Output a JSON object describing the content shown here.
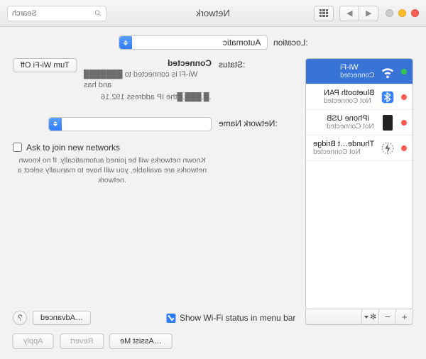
{
  "window": {
    "title": "Network",
    "search_placeholder": "Search"
  },
  "location": {
    "label": "Location:",
    "value": "Automatic"
  },
  "services": [
    {
      "id": "wifi",
      "name": "Wi-Fi",
      "status": "Connected",
      "dot": "green",
      "icon": "wifi",
      "selected": true
    },
    {
      "id": "btpan",
      "name": "Bluetooth PAN",
      "status": "Not Connected",
      "dot": "red",
      "icon": "bluetooth",
      "selected": false
    },
    {
      "id": "iphone",
      "name": "iPhone USB",
      "status": "Not Connected",
      "dot": "red",
      "icon": "phone",
      "selected": false
    },
    {
      "id": "tbridge",
      "name": "Thunde…t Bridge",
      "status": "Not Connected",
      "dot": "red",
      "icon": "thunderbolt",
      "selected": false
    }
  ],
  "detail": {
    "status_label": "Status:",
    "status_value": "Connected",
    "turn_off_label": "Turn Wi-Fi Off",
    "status_desc_1": "Wi-Fi is connected to ███████ and has",
    "status_desc_2": "the IP address 192.16█.███.█.",
    "network_name_label": "Network Name:",
    "network_name_value": "",
    "ask_join_label": "Ask to join new networks",
    "ask_join_desc": "Known networks will be joined automatically. If no known networks are available, you will have to manually select a network.",
    "show_menu_label": "Show Wi-Fi status in menu bar",
    "advanced_label": "Advanced…",
    "help_label": "?"
  },
  "footer": {
    "assist": "Assist Me…",
    "revert": "Revert",
    "apply": "Apply"
  }
}
